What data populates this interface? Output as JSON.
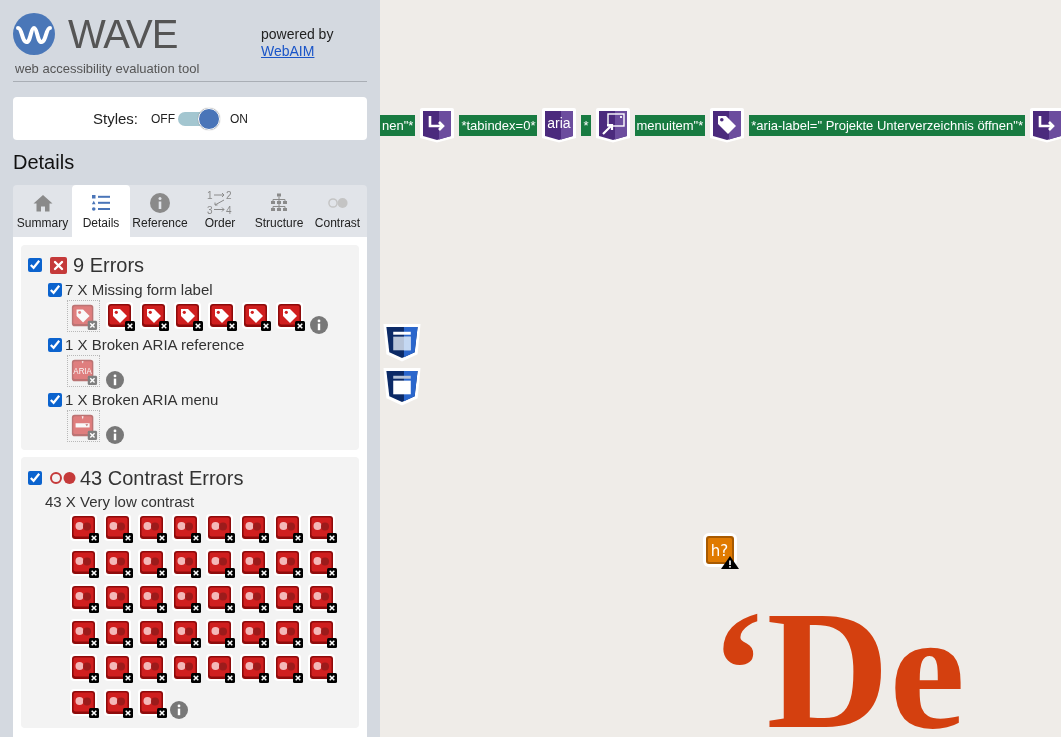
{
  "sidebar": {
    "logo": {
      "wordmark": "WAVE",
      "tagline": "web accessibility evaluation tool"
    },
    "powered_by": {
      "text": "powered by",
      "link": "WebAIM"
    },
    "styles_toggle": {
      "label": "Styles:",
      "off_label": "OFF",
      "on_label": "ON",
      "on": true
    },
    "heading": "Details",
    "tabs": [
      {
        "label": "Summary",
        "selected": false
      },
      {
        "label": "Details",
        "selected": true
      },
      {
        "label": "Reference",
        "selected": false
      },
      {
        "label": "Order",
        "selected": false,
        "icon_digits": [
          "1",
          "2",
          "3",
          "4"
        ]
      },
      {
        "label": "Structure",
        "selected": false
      },
      {
        "label": "Contrast",
        "selected": false
      }
    ],
    "categories": [
      {
        "kind": "errors",
        "title": "9 Errors",
        "checked": true,
        "items": [
          {
            "kind": "label",
            "label": "7 X Missing form label",
            "checked": true,
            "instances": [
              {
                "selected": true
              },
              {
                "selected": false
              },
              {
                "selected": false
              },
              {
                "selected": false
              },
              {
                "selected": false
              },
              {
                "selected": false
              },
              {
                "selected": false
              }
            ]
          },
          {
            "kind": "aria",
            "label": "1 X Broken ARIA reference",
            "checked": true,
            "icon_text": "ARIA",
            "instances": [
              {
                "selected": true
              }
            ]
          },
          {
            "kind": "menu",
            "label": "1 X Broken ARIA menu",
            "checked": true,
            "instances": [
              {
                "selected": true
              }
            ]
          }
        ]
      },
      {
        "kind": "contrast",
        "title": "43 Contrast Errors",
        "checked": true,
        "items": [
          {
            "kind": "contrast",
            "label": "43 X Very low contrast",
            "instances": [
              {
                "selected": false
              },
              {
                "selected": false
              },
              {
                "selected": false
              },
              {
                "selected": false
              },
              {
                "selected": false
              },
              {
                "selected": false
              },
              {
                "selected": false
              },
              {
                "selected": false
              },
              {
                "selected": false
              },
              {
                "selected": false
              },
              {
                "selected": false
              },
              {
                "selected": false
              },
              {
                "selected": false
              },
              {
                "selected": false
              },
              {
                "selected": false
              },
              {
                "selected": false
              },
              {
                "selected": false
              },
              {
                "selected": false
              },
              {
                "selected": false
              },
              {
                "selected": false
              },
              {
                "selected": false
              },
              {
                "selected": false
              },
              {
                "selected": false
              },
              {
                "selected": false
              },
              {
                "selected": false
              },
              {
                "selected": false
              },
              {
                "selected": false
              },
              {
                "selected": false
              },
              {
                "selected": false
              },
              {
                "selected": false
              },
              {
                "selected": false
              },
              {
                "selected": false
              },
              {
                "selected": false
              },
              {
                "selected": false
              },
              {
                "selected": false
              },
              {
                "selected": false
              },
              {
                "selected": false
              },
              {
                "selected": false
              },
              {
                "selected": false
              },
              {
                "selected": false
              },
              {
                "selected": false
              },
              {
                "selected": false
              },
              {
                "selected": false
              }
            ]
          }
        ]
      }
    ]
  },
  "page": {
    "annotations": [
      {
        "kind": "code",
        "text": "nen\"*"
      },
      {
        "kind": "arrow"
      },
      {
        "kind": "code",
        "text": "*tabindex=0*"
      },
      {
        "kind": "aria",
        "text": "aria"
      },
      {
        "kind": "code",
        "text": "*"
      },
      {
        "kind": "popup"
      },
      {
        "kind": "code",
        "text": "menuitem\"*"
      },
      {
        "kind": "tag"
      },
      {
        "kind": "code",
        "text": "*aria-label=\" Projekte Unterverzeichnis öffnen\"*"
      },
      {
        "kind": "arrow"
      }
    ],
    "alert": {
      "text": "h?"
    },
    "headline": "‘De"
  }
}
